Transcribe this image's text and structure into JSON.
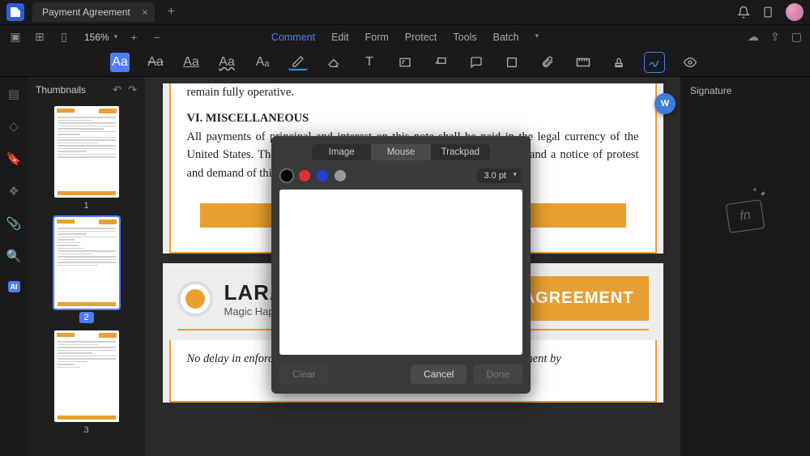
{
  "titlebar": {
    "tab_title": "Payment Agreement"
  },
  "viewbar": {
    "zoom": "156%",
    "menu": [
      "Comment",
      "Edit",
      "Form",
      "Protect",
      "Tools",
      "Batch"
    ]
  },
  "thumbs": {
    "title": "Thumbnails",
    "pages": [
      "1",
      "2",
      "3"
    ]
  },
  "document": {
    "page1": {
      "line1": "remain fully operative.",
      "heading": "VI. MISCELLANEOUS",
      "para": "All payments of principal and interest on this note shall be paid in the legal currency of the United States. The borrower waives presentment for payment, protest, and a notice of protest and demand of this note."
    },
    "page2": {
      "logo_title": "LARANA, INC.",
      "logo_sub": "Magic Happens With Content",
      "badge": "PAYMENT AGREEMENT",
      "para": "No delay in enforcing any right of the Lender under this Note, or assignment by"
    }
  },
  "rightsidebar": {
    "title": "Signature"
  },
  "modal": {
    "tabs": [
      "Image",
      "Mouse",
      "Trackpad"
    ],
    "colors": [
      "#000000",
      "#e03030",
      "#2040e0",
      "#999999"
    ],
    "thickness": "3.0 pt",
    "buttons": {
      "clear": "Clear",
      "cancel": "Cancel",
      "done": "Done"
    }
  }
}
